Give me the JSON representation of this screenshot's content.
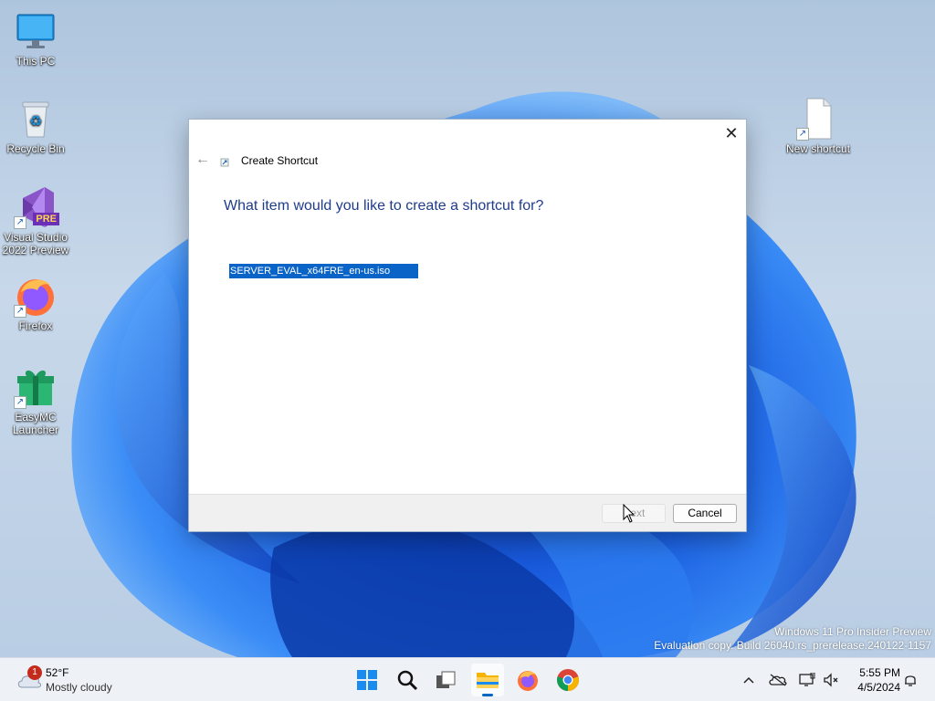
{
  "desktop": {
    "icons": [
      {
        "label": "This PC",
        "icon": "monitor-icon"
      },
      {
        "label": "Recycle Bin",
        "icon": "recycle-bin-icon"
      },
      {
        "label": "Visual Studio 2022 Preview",
        "icon": "visual-studio-icon",
        "badge": "PRE"
      },
      {
        "label": "Firefox",
        "icon": "firefox-icon"
      },
      {
        "label": "EasyMC Launcher",
        "icon": "gift-icon"
      },
      {
        "label": "New shortcut",
        "icon": "file-icon"
      }
    ]
  },
  "dialog": {
    "title": "Create Shortcut",
    "question": "What item would you like to create a shortcut for?",
    "location_value": "SERVER_EVAL_x64FRE_en-us.iso",
    "next_label": "Next",
    "cancel_label": "Cancel",
    "close_glyph": "✕",
    "back_glyph": "←"
  },
  "watermark": {
    "line1": "Windows 11 Pro Insider Preview",
    "line2": "Evaluation copy. Build 26040.rs_prerelease.240122-1157"
  },
  "taskbar": {
    "weather": {
      "temp": "52°F",
      "condition": "Mostly cloudy",
      "badge": "1"
    },
    "apps": [
      "start-icon",
      "search-icon",
      "task-view-icon",
      "file-explorer-icon",
      "firefox-icon",
      "chrome-icon"
    ],
    "active_app": "file-explorer-icon",
    "tray_chevron": "^",
    "clock": {
      "time": "5:55 PM",
      "date": "4/5/2024"
    }
  },
  "colors": {
    "accent": "#0067c0",
    "selection": "#0a64c8",
    "heading": "#1e3c8c",
    "wallpaper_blue": "#1a6be0"
  }
}
